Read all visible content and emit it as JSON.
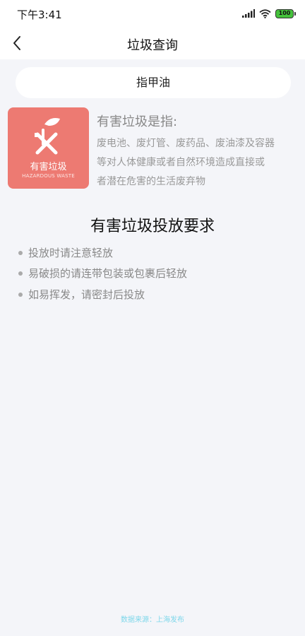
{
  "status_bar": {
    "time": "下午3:41",
    "battery": "100"
  },
  "nav": {
    "title": "垃圾查询"
  },
  "search": {
    "query": "指甲油"
  },
  "category": {
    "name_cn": "有害垃圾",
    "name_en": "HAZARDOUS WASTE",
    "color": "#ed7a72",
    "icon": "hazardous-waste-icon"
  },
  "definition": {
    "title": "有害垃圾是指:",
    "lines": [
      "废电池、废灯管、废药品、废油漆及容器",
      "等对人体健康或者自然环境造成直接或",
      "者潜在危害的生活废弃物"
    ]
  },
  "requirements": {
    "title": "有害垃圾投放要求",
    "items": [
      "投放时请注意轻放",
      "易破损的请连带包装或包裹后轻放",
      "如易挥发，请密封后投放"
    ]
  },
  "footer": {
    "source": "数据来源：上海发布"
  }
}
